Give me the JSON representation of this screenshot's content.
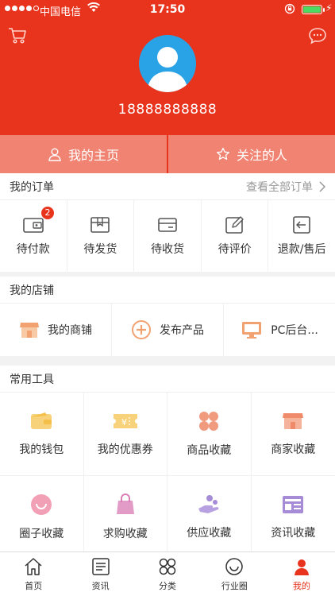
{
  "status_bar": {
    "carrier": "中国电信",
    "time": "17:50"
  },
  "profile": {
    "phone": "18888888888"
  },
  "tabs": [
    {
      "label": "我的主页",
      "icon": "person-icon"
    },
    {
      "label": "关注的人",
      "icon": "star-icon"
    }
  ],
  "orders": {
    "title": "我的订单",
    "view_all": "查看全部订单",
    "items": [
      {
        "label": "待付款",
        "icon": "wallet-icon",
        "badge": "2"
      },
      {
        "label": "待发货",
        "icon": "box-icon"
      },
      {
        "label": "待收货",
        "icon": "card-icon"
      },
      {
        "label": "待评价",
        "icon": "edit-icon"
      },
      {
        "label": "退款/售后",
        "icon": "return-icon"
      }
    ]
  },
  "store": {
    "title": "我的店铺",
    "items": [
      {
        "label": "我的商铺",
        "icon": "shop-icon"
      },
      {
        "label": "发布产品",
        "icon": "plus-circle-icon"
      },
      {
        "label": "PC后台...",
        "icon": "monitor-icon"
      }
    ]
  },
  "tools": {
    "title": "常用工具",
    "items": [
      {
        "label": "我的钱包",
        "icon": "wallet-icon"
      },
      {
        "label": "我的优惠券",
        "icon": "coupon-icon"
      },
      {
        "label": "商品收藏",
        "icon": "grid-icon"
      },
      {
        "label": "商家收藏",
        "icon": "shop-icon"
      },
      {
        "label": "圈子收藏",
        "icon": "smile-icon"
      },
      {
        "label": "求购收藏",
        "icon": "bag-icon"
      },
      {
        "label": "供应收藏",
        "icon": "hand-icon"
      },
      {
        "label": "资讯收藏",
        "icon": "news-icon"
      }
    ]
  },
  "tabbar": [
    {
      "label": "首页",
      "icon": "home-icon"
    },
    {
      "label": "资讯",
      "icon": "news-icon"
    },
    {
      "label": "分类",
      "icon": "category-icon"
    },
    {
      "label": "行业圈",
      "icon": "circle-icon"
    },
    {
      "label": "我的",
      "icon": "profile-icon",
      "active": true
    }
  ],
  "colors": {
    "brand": "#e8331d",
    "tab_bg": "#f08372",
    "avatar_bg": "#2aa3e6"
  }
}
